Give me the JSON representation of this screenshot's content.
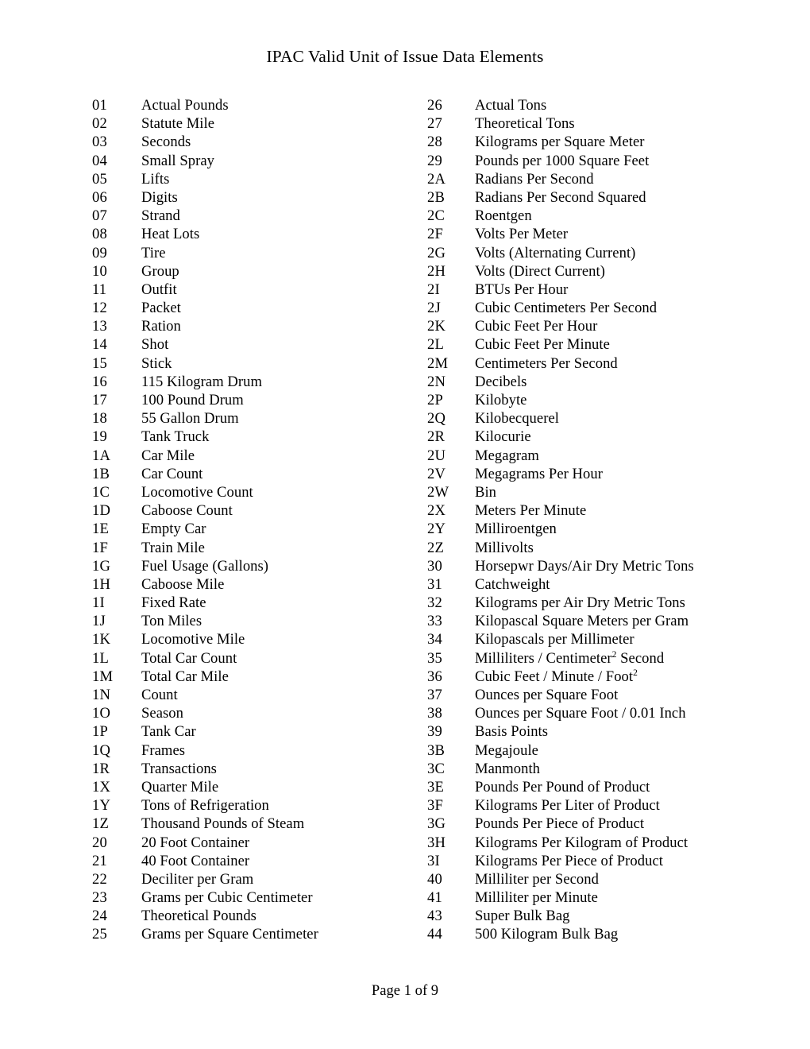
{
  "document": {
    "title": "IPAC Valid Unit of Issue Data Elements",
    "footer": "Page 1 of 9"
  },
  "columns": {
    "left": [
      {
        "code": "01",
        "label": "Actual Pounds"
      },
      {
        "code": "02",
        "label": "Statute Mile"
      },
      {
        "code": "03",
        "label": "Seconds"
      },
      {
        "code": "04",
        "label": "Small Spray"
      },
      {
        "code": "05",
        "label": "Lifts"
      },
      {
        "code": "06",
        "label": "Digits"
      },
      {
        "code": "07",
        "label": "Strand"
      },
      {
        "code": "08",
        "label": "Heat Lots"
      },
      {
        "code": "09",
        "label": "Tire"
      },
      {
        "code": "10",
        "label": "Group"
      },
      {
        "code": "11",
        "label": "Outfit"
      },
      {
        "code": "12",
        "label": "Packet"
      },
      {
        "code": "13",
        "label": "Ration"
      },
      {
        "code": "14",
        "label": "Shot"
      },
      {
        "code": "15",
        "label": "Stick"
      },
      {
        "code": "16",
        "label": "115 Kilogram Drum"
      },
      {
        "code": "17",
        "label": "100 Pound Drum"
      },
      {
        "code": "18",
        "label": "55 Gallon Drum"
      },
      {
        "code": "19",
        "label": "Tank Truck"
      },
      {
        "code": "1A",
        "label": "Car Mile"
      },
      {
        "code": "1B",
        "label": "Car Count"
      },
      {
        "code": "1C",
        "label": "Locomotive Count"
      },
      {
        "code": "1D",
        "label": "Caboose Count"
      },
      {
        "code": "1E",
        "label": "Empty Car"
      },
      {
        "code": "1F",
        "label": "Train Mile"
      },
      {
        "code": "1G",
        "label": "Fuel Usage (Gallons)"
      },
      {
        "code": "1H",
        "label": "Caboose Mile"
      },
      {
        "code": "1I",
        "label": "Fixed Rate"
      },
      {
        "code": "1J",
        "label": "Ton Miles"
      },
      {
        "code": "1K",
        "label": "Locomotive Mile"
      },
      {
        "code": "1L",
        "label": "Total Car Count"
      },
      {
        "code": "1M",
        "label": "Total Car Mile"
      },
      {
        "code": "1N",
        "label": "Count"
      },
      {
        "code": "1O",
        "label": "Season"
      },
      {
        "code": "1P",
        "label": "Tank Car"
      },
      {
        "code": "1Q",
        "label": "Frames"
      },
      {
        "code": "1R",
        "label": "Transactions"
      },
      {
        "code": "1X",
        "label": "Quarter Mile"
      },
      {
        "code": "1Y",
        "label": "Tons of Refrigeration"
      },
      {
        "code": "1Z",
        "label": "Thousand Pounds of Steam"
      },
      {
        "code": "20",
        "label": "20 Foot Container"
      },
      {
        "code": "21",
        "label": "40 Foot Container"
      },
      {
        "code": "22",
        "label": "Deciliter per Gram"
      },
      {
        "code": "23",
        "label": "Grams per Cubic Centimeter"
      },
      {
        "code": "24",
        "label": "Theoretical Pounds"
      },
      {
        "code": "25",
        "label": "Grams per Square Centimeter"
      }
    ],
    "right": [
      {
        "code": "26",
        "label": "Actual Tons"
      },
      {
        "code": "27",
        "label": "Theoretical Tons"
      },
      {
        "code": "28",
        "label": "Kilograms per Square Meter"
      },
      {
        "code": "29",
        "label": "Pounds per 1000 Square Feet"
      },
      {
        "code": "2A",
        "label": "Radians Per Second"
      },
      {
        "code": "2B",
        "label": "Radians Per Second Squared"
      },
      {
        "code": "2C",
        "label": "Roentgen"
      },
      {
        "code": "2F",
        "label": "Volts Per Meter"
      },
      {
        "code": "2G",
        "label": "Volts (Alternating Current)"
      },
      {
        "code": "2H",
        "label": "Volts (Direct Current)"
      },
      {
        "code": "2I",
        "label": "BTUs Per Hour"
      },
      {
        "code": "2J",
        "label": "Cubic Centimeters Per Second"
      },
      {
        "code": "2K",
        "label": "Cubic Feet Per Hour"
      },
      {
        "code": "2L",
        "label": "Cubic Feet Per Minute"
      },
      {
        "code": "2M",
        "label": "Centimeters Per Second"
      },
      {
        "code": "2N",
        "label": "Decibels"
      },
      {
        "code": "2P",
        "label": "Kilobyte"
      },
      {
        "code": "2Q",
        "label": "Kilobecquerel"
      },
      {
        "code": "2R",
        "label": "Kilocurie"
      },
      {
        "code": "2U",
        "label": "Megagram"
      },
      {
        "code": "2V",
        "label": "Megagrams Per Hour"
      },
      {
        "code": "2W",
        "label": "Bin"
      },
      {
        "code": "2X",
        "label": "Meters Per Minute"
      },
      {
        "code": "2Y",
        "label": "Milliroentgen"
      },
      {
        "code": "2Z",
        "label": "Millivolts"
      },
      {
        "code": "30",
        "label": "Horsepwr Days/Air Dry Metric Tons"
      },
      {
        "code": "31",
        "label": "Catchweight"
      },
      {
        "code": "32",
        "label": "Kilograms per Air Dry Metric Tons"
      },
      {
        "code": "33",
        "label": "Kilopascal Square Meters per Gram"
      },
      {
        "code": "34",
        "label": "Kilopascals per Millimeter"
      },
      {
        "code": "35",
        "label": "Milliliters / Centimeter",
        "sup": "2",
        "label_after": " Second"
      },
      {
        "code": "36",
        "label": "Cubic Feet / Minute / Foot",
        "sup": "2",
        "label_after": ""
      },
      {
        "code": "37",
        "label": "Ounces per Square Foot"
      },
      {
        "code": "38",
        "label": "Ounces per Square Foot / 0.01 Inch"
      },
      {
        "code": "39",
        "label": "Basis Points"
      },
      {
        "code": "3B",
        "label": "Megajoule"
      },
      {
        "code": "3C",
        "label": "Manmonth"
      },
      {
        "code": "3E",
        "label": "Pounds Per Pound of Product"
      },
      {
        "code": "3F",
        "label": "Kilograms Per Liter of Product"
      },
      {
        "code": "3G",
        "label": "Pounds Per Piece of Product"
      },
      {
        "code": "3H",
        "label": "Kilograms Per Kilogram of Product"
      },
      {
        "code": "3I",
        "label": "Kilograms Per Piece of Product"
      },
      {
        "code": "40",
        "label": "Milliliter per Second"
      },
      {
        "code": "41",
        "label": "Milliliter per Minute"
      },
      {
        "code": "43",
        "label": "Super Bulk Bag"
      },
      {
        "code": "44",
        "label": "500 Kilogram Bulk Bag"
      }
    ]
  }
}
